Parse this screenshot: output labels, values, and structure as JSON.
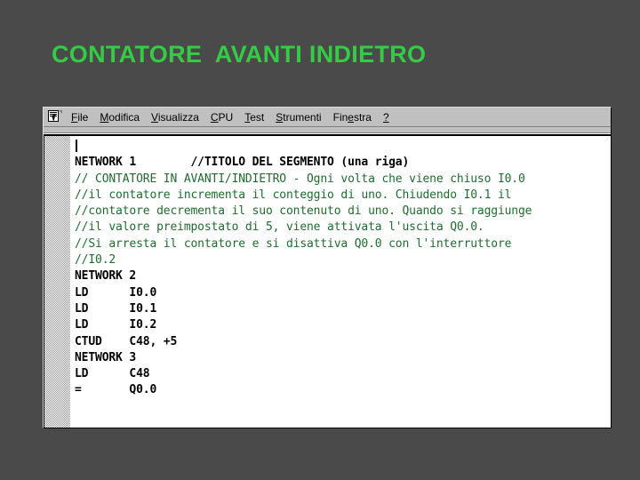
{
  "slide": {
    "title": "CONTATORE  AVANTI INDIETRO",
    "title_color": "#33cc44",
    "background_color": "#4a4a4a"
  },
  "window": {
    "chrome_color": "#c0c0c0",
    "client_background": "#ffffff"
  },
  "menu_bar": {
    "icon": "document-window-icon",
    "items": [
      {
        "name": "file",
        "pre": "",
        "acc": "F",
        "post": "ile"
      },
      {
        "name": "modifica",
        "pre": "",
        "acc": "M",
        "post": "odifica"
      },
      {
        "name": "visualizza",
        "pre": "",
        "acc": "V",
        "post": "isualizza"
      },
      {
        "name": "cpu",
        "pre": "",
        "acc": "C",
        "post": "PU"
      },
      {
        "name": "test",
        "pre": "",
        "acc": "T",
        "post": "est"
      },
      {
        "name": "strumenti",
        "pre": "",
        "acc": "S",
        "post": "trumenti"
      },
      {
        "name": "finestra",
        "pre": "Fin",
        "acc": "e",
        "post": "stra"
      },
      {
        "name": "help",
        "pre": "",
        "acc": "?",
        "post": ""
      }
    ]
  },
  "editor": {
    "comment_color": "#1f6b2f",
    "code_color": "#000000",
    "caret_visible": true,
    "lines": [
      {
        "kind": "code",
        "text": "NETWORK 1        //TITOLO DEL SEGMENTO (una riga)"
      },
      {
        "kind": "comment",
        "text": "// CONTATORE IN AVANTI/INDIETRO - Ogni volta che viene chiuso I0.0"
      },
      {
        "kind": "comment",
        "text": "//il contatore incrementa il conteggio di uno. Chiudendo I0.1 il"
      },
      {
        "kind": "comment",
        "text": "//contatore decrementa il suo contenuto di uno. Quando si raggiunge"
      },
      {
        "kind": "comment",
        "text": "//il valore preimpostato di 5, viene attivata l'uscita Q0.0."
      },
      {
        "kind": "comment",
        "text": "//Si arresta il contatore e si disattiva Q0.0 con l'interruttore"
      },
      {
        "kind": "comment",
        "text": "//I0.2"
      },
      {
        "kind": "code",
        "text": "NETWORK 2"
      },
      {
        "kind": "code",
        "text": "LD      I0.0"
      },
      {
        "kind": "code",
        "text": "LD      I0.1"
      },
      {
        "kind": "code",
        "text": "LD      I0.2"
      },
      {
        "kind": "code",
        "text": "CTUD    C48, +5"
      },
      {
        "kind": "code",
        "text": "NETWORK 3"
      },
      {
        "kind": "code",
        "text": "LD      C48"
      },
      {
        "kind": "code",
        "text": "=       Q0.0"
      }
    ]
  }
}
